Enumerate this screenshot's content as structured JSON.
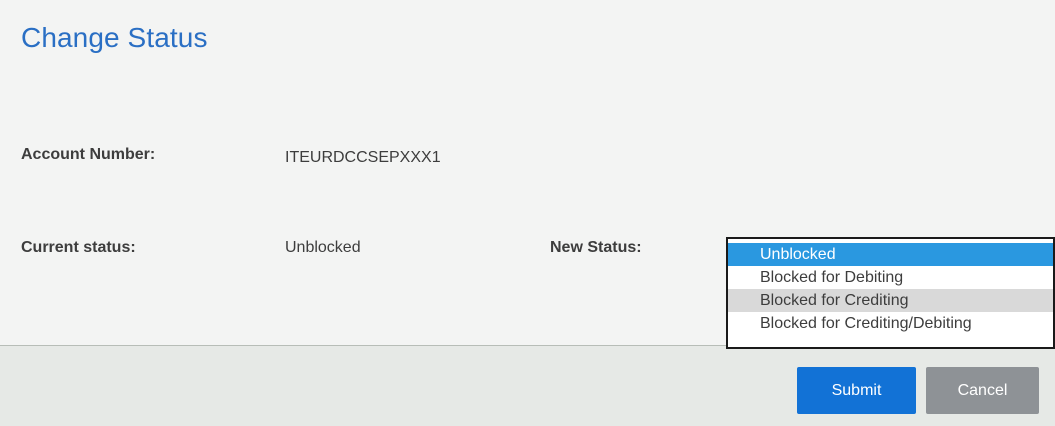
{
  "page": {
    "title": "Change Status"
  },
  "form": {
    "account_number_label": "Account Number:",
    "account_number_value": "ITEURDCCSEPXXX1",
    "current_status_label": "Current status:",
    "current_status_value": "Unblocked",
    "new_status_label": "New Status:"
  },
  "new_status_dropdown": {
    "selected_value": "Unblocked",
    "highlighted_value": "Blocked for Crediting",
    "options": [
      "Unblocked",
      "Blocked for Debiting",
      "Blocked for Crediting",
      "Blocked for Crediting/Debiting"
    ]
  },
  "actions": {
    "submit_label": "Submit",
    "cancel_label": "Cancel"
  },
  "colors": {
    "title": "#2a6fc4",
    "selected_option": "#2a98e0",
    "highlighted_option": "#d9d9d9",
    "submit_button": "#1272d6",
    "cancel_button": "#8e9296",
    "panel_background": "#f3f4f3",
    "footer_background": "#e6e9e6"
  }
}
